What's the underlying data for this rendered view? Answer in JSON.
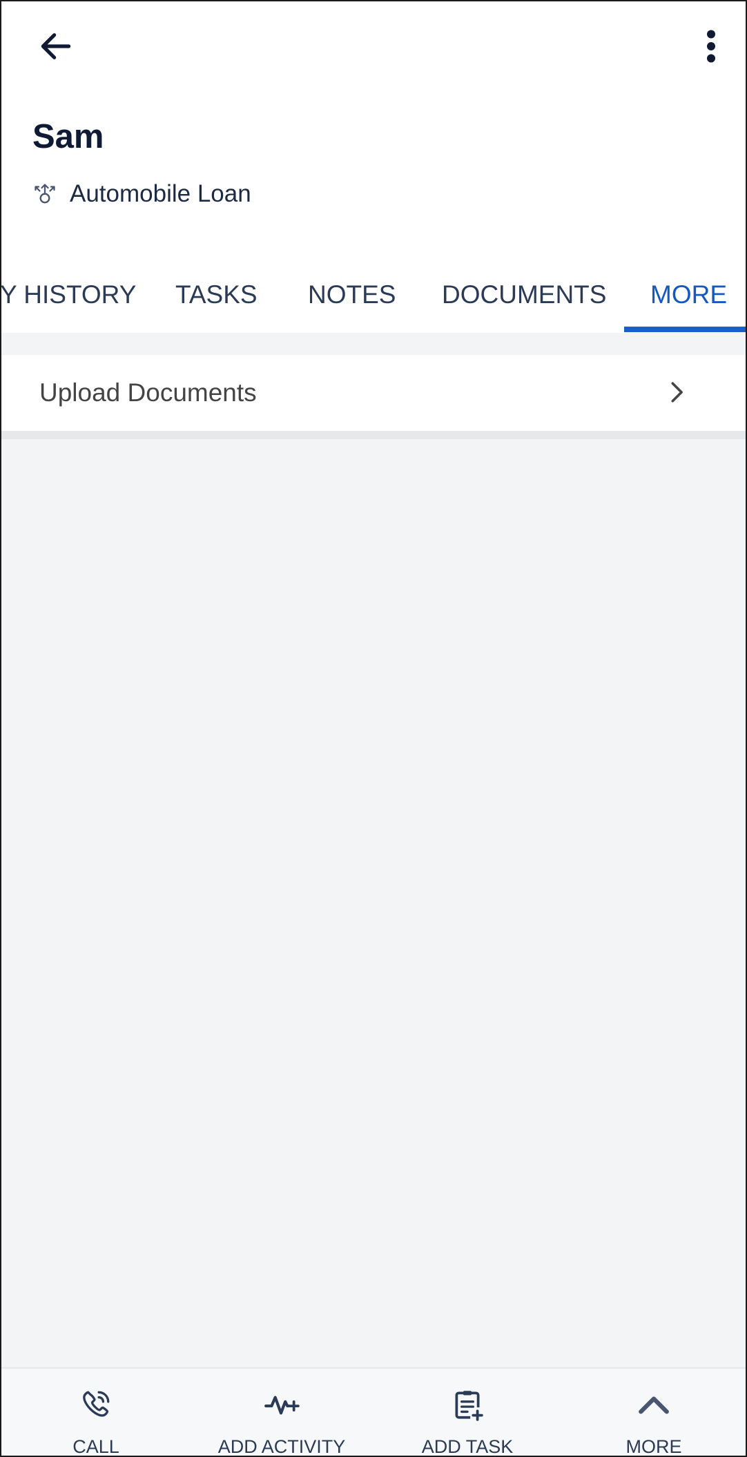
{
  "header": {
    "name": "Sam",
    "subtitle": "Automobile Loan",
    "subtitle_icon": "lead-transfer-icon",
    "back_icon": "arrow-left-icon",
    "overflow_icon": "more-vertical-icon"
  },
  "tabs": [
    {
      "label": "Y HISTORY",
      "active": false
    },
    {
      "label": "TASKS",
      "active": false
    },
    {
      "label": "NOTES",
      "active": false
    },
    {
      "label": "DOCUMENTS",
      "active": false
    },
    {
      "label": "MORE",
      "active": true
    }
  ],
  "more_list": {
    "items": [
      {
        "label": "Upload Documents",
        "icon": "chevron-right-icon"
      }
    ]
  },
  "bottom_bar": {
    "items": [
      {
        "label": "CALL",
        "icon": "phone-icon"
      },
      {
        "label": "ADD ACTIVITY",
        "icon": "activity-plus-icon"
      },
      {
        "label": "ADD TASK",
        "icon": "clipboard-plus-icon"
      },
      {
        "label": "MORE",
        "icon": "chevron-up-icon"
      }
    ]
  },
  "colors": {
    "accent": "#1a5fc8",
    "text_primary": "#0f1b34",
    "background": "#f3f4f6"
  }
}
